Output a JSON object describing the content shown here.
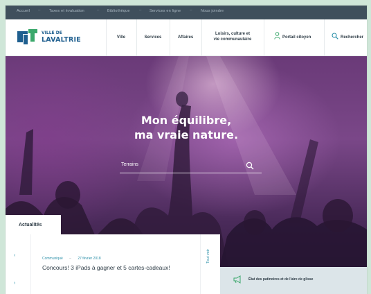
{
  "topbar": {
    "links": [
      "Accueil",
      "Taxes et évaluation",
      "Bibliothèque",
      "Services en ligne",
      "Nous joindre"
    ]
  },
  "logo": {
    "line1": "VILLE DE",
    "line2": "LAVALTRIE",
    "color": "#1f5f8f",
    "accent": "#3aa86b"
  },
  "nav": {
    "ville": "Ville",
    "services": "Services",
    "affaires": "Affaires",
    "loisirs_l1": "Loisirs, culture et",
    "loisirs_l2": "vie communautaire",
    "portail": "Portail citoyen",
    "rechercher": "Rechercher"
  },
  "hero": {
    "title_l1": "Mon équilibre,",
    "title_l2": "ma vraie nature.",
    "search_placeholder": "Terrains"
  },
  "news": {
    "tab_label": "Actualités",
    "category": "Communiqué",
    "date": "27 février 2018",
    "title": "Concours! 3 iPads à gagner et 5 cartes-cadeaux!",
    "see_all": "Tout voir"
  },
  "status": {
    "text": "État des patinoires et de l'aire de glisse"
  },
  "colors": {
    "topbar": "#3f4f5c",
    "accent": "#2a8fa8",
    "brand_green": "#3aa86b"
  }
}
